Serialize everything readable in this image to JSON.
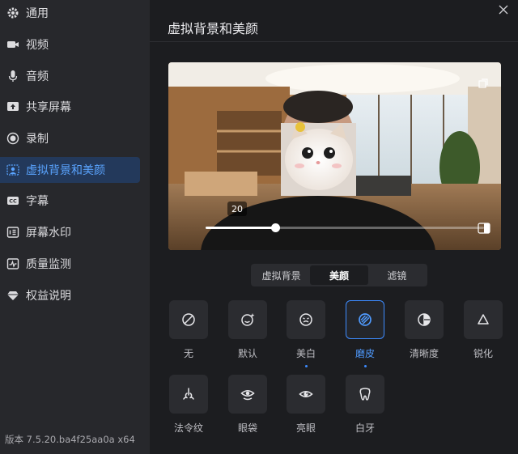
{
  "sidebar": {
    "items": [
      {
        "label": "通用",
        "icon": "gear-icon"
      },
      {
        "label": "视频",
        "icon": "camera-icon"
      },
      {
        "label": "音频",
        "icon": "microphone-icon"
      },
      {
        "label": "共享屏幕",
        "icon": "share-screen-icon"
      },
      {
        "label": "录制",
        "icon": "record-icon"
      },
      {
        "label": "虚拟背景和美颜",
        "icon": "virtual-background-icon"
      },
      {
        "label": "字幕",
        "icon": "captions-icon"
      },
      {
        "label": "屏幕水印",
        "icon": "watermark-icon"
      },
      {
        "label": "质量监测",
        "icon": "quality-monitor-icon"
      },
      {
        "label": "权益说明",
        "icon": "diamond-icon"
      }
    ],
    "active_index": 5,
    "version": "版本 7.5.20.ba4f25aa0a x64"
  },
  "main": {
    "title": "虚拟背景和美颜",
    "close_icon": "close-icon",
    "preview": {
      "slider_value": "20",
      "slider_fraction": 0.25,
      "mirror_icon": "mirror-icon",
      "corner_icon": "fullscreen-icon"
    },
    "tabs": [
      {
        "label": "虚拟背景"
      },
      {
        "label": "美颜"
      },
      {
        "label": "滤镜"
      }
    ],
    "active_tab": 1,
    "effects": [
      {
        "label": "无",
        "icon": "none-icon"
      },
      {
        "label": "默认",
        "icon": "smile-sparkle-icon"
      },
      {
        "label": "美白",
        "icon": "whitening-icon",
        "dot": true
      },
      {
        "label": "磨皮",
        "icon": "smoothing-icon",
        "selected": true,
        "dot": true
      },
      {
        "label": "清晰度",
        "icon": "clarity-icon"
      },
      {
        "label": "锐化",
        "icon": "sharpen-icon"
      },
      {
        "label": "法令纹",
        "icon": "nose-icon"
      },
      {
        "label": "眼袋",
        "icon": "eye-bag-icon"
      },
      {
        "label": "亮眼",
        "icon": "bright-eye-icon"
      },
      {
        "label": "白牙",
        "icon": "tooth-icon"
      }
    ],
    "accent_color": "#3d8bff"
  }
}
